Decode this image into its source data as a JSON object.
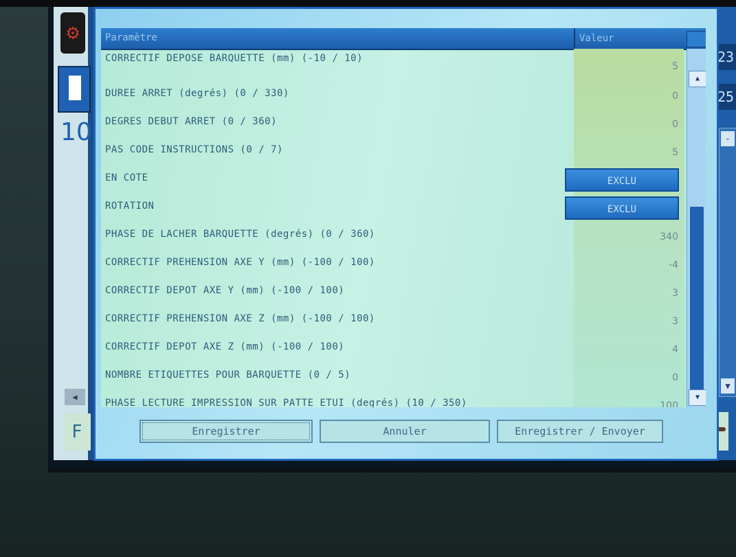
{
  "dialog": {
    "header": {
      "param_col": "Paramètre",
      "value_col": "Valeur"
    },
    "rows": [
      {
        "label": "CORRECTIF DEPOSE BARQUETTE (mm) (-10 / 10)",
        "value": "5"
      },
      {
        "label": "DUREE ARRET (degrés) (0 / 330)",
        "value": "0"
      },
      {
        "label": "DEGRES DEBUT ARRET (0 / 360)",
        "value": "0"
      },
      {
        "label": "PAS CODE INSTRUCTIONS (0 / 7)",
        "value": "5"
      },
      {
        "label": "EN COTE",
        "pill": "EXCLU"
      },
      {
        "label": "ROTATION",
        "pill": "EXCLU"
      },
      {
        "label": "PHASE DE LACHER BARQUETTE (degrés) (0 / 360)",
        "value": "340"
      },
      {
        "label": "CORRECTIF PREHENSION AXE Y (mm) (-100 / 100)",
        "value": "-4"
      },
      {
        "label": "CORRECTIF DEPOT AXE Y (mm) (-100 / 100)",
        "value": "3"
      },
      {
        "label": "CORRECTIF PREHENSION AXE Z (mm) (-100 / 100)",
        "value": "3"
      },
      {
        "label": "CORRECTIF DEPOT AXE Z (mm) (-100 / 100)",
        "value": "4"
      },
      {
        "label": "NOMBRE ETIQUETTES POUR BARQUETTE (0 / 5)",
        "value": "0"
      },
      {
        "label": "PHASE LECTURE IMPRESSION SUR PATTE ETUI (degrés) (10 / 350)",
        "value": "100"
      }
    ],
    "buttons": {
      "save": "Enregistrer",
      "cancel": "Annuler",
      "save_send": "Enregistrer / Envoyer"
    }
  },
  "background": {
    "big_number": "10",
    "right_item_1": "23",
    "right_item_2": "25",
    "left_button": "F"
  },
  "icons": {
    "logo": "gear-logo-icon",
    "scroll_up": "arrow-up-icon",
    "scroll_down": "arrow-down-icon",
    "left_scroll": "arrow-left-icon"
  },
  "colors": {
    "dialog_border": "#1e64b8",
    "header": "#2d7ecf",
    "grid_bg": "#c6f1e5",
    "pill": "#1f6bc0"
  }
}
